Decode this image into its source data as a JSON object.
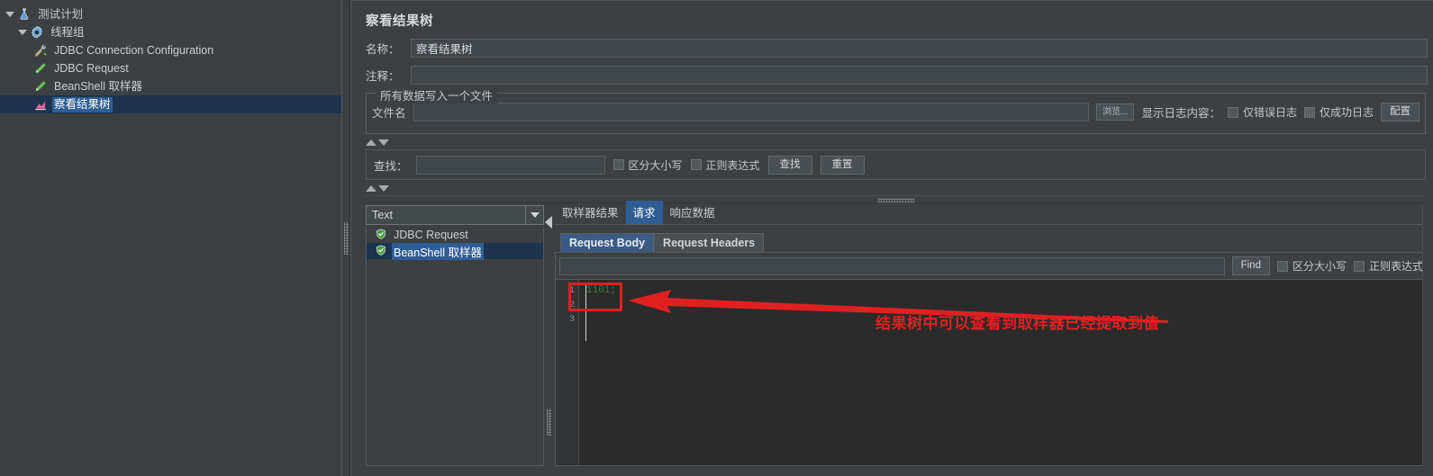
{
  "tree": {
    "nodes": [
      {
        "label": "测试计划",
        "icon": "flask-icon",
        "indent": 1,
        "expanded": true,
        "selected": false
      },
      {
        "label": "线程组",
        "icon": "gear-icon",
        "indent": 2,
        "expanded": true,
        "selected": false
      },
      {
        "label": "JDBC Connection Configuration",
        "icon": "wrench-screwdriver-icon",
        "indent": 3,
        "expanded": false,
        "selected": false
      },
      {
        "label": "JDBC Request",
        "icon": "pencil-icon",
        "indent": 3,
        "expanded": false,
        "selected": false
      },
      {
        "label": "BeanShell 取样器",
        "icon": "pencil-icon",
        "indent": 3,
        "expanded": false,
        "selected": false
      },
      {
        "label": "察看结果树",
        "icon": "chart-icon",
        "indent": 3,
        "expanded": false,
        "selected": true
      }
    ]
  },
  "panel": {
    "title": "察看结果树",
    "name_label": "名称：",
    "name_value": "察看结果树",
    "comment_label": "注释：",
    "comment_value": "",
    "comment_placeholder": ""
  },
  "filegroup": {
    "title": "所有数据写入一个文件",
    "filename_label": "文件名",
    "filename_value": "",
    "browse_button": "浏览...",
    "log_display_label": "显示日志内容：",
    "errors_only_label": "仅错误日志",
    "errors_only_checked": false,
    "success_only_label": "仅成功日志",
    "success_only_checked": false,
    "configure_button": "配置"
  },
  "search": {
    "label": "查找：",
    "value": "",
    "case_sensitive_label": "区分大小写",
    "case_sensitive_checked": false,
    "regex_label": "正则表达式",
    "regex_checked": false,
    "find_button": "查找",
    "reset_button": "重置"
  },
  "results": {
    "render_selected": "Text",
    "items": [
      {
        "label": "JDBC Request",
        "status": "success",
        "selected": false
      },
      {
        "label": "BeanShell 取样器",
        "status": "success",
        "selected": true
      }
    ]
  },
  "detail": {
    "tabs": [
      {
        "label": "取样器结果",
        "active": false
      },
      {
        "label": "请求",
        "active": true
      },
      {
        "label": "响应数据",
        "active": false
      }
    ],
    "subtabs": [
      {
        "label": "Request Body",
        "active": true
      },
      {
        "label": "Request Headers",
        "active": false
      }
    ],
    "find": {
      "value": "",
      "find_button": "Find",
      "case_sensitive_label": "区分大小写",
      "case_sensitive_checked": false,
      "regex_label": "正则表达式",
      "regex_checked": false
    },
    "editor": {
      "line_numbers": [
        "1",
        "2",
        "3"
      ],
      "lines": [
        "1101;",
        "",
        ""
      ]
    }
  },
  "annotation": {
    "text": "结果树中可以查看到取样器已经提取到值",
    "color": "#e02020"
  },
  "colors": {
    "window_bg": "#3c4043",
    "selection_blue": "#2f5d96",
    "editor_bg": "#2b2b2b",
    "annotation_red": "#e02020",
    "text": "#c8ccce"
  }
}
